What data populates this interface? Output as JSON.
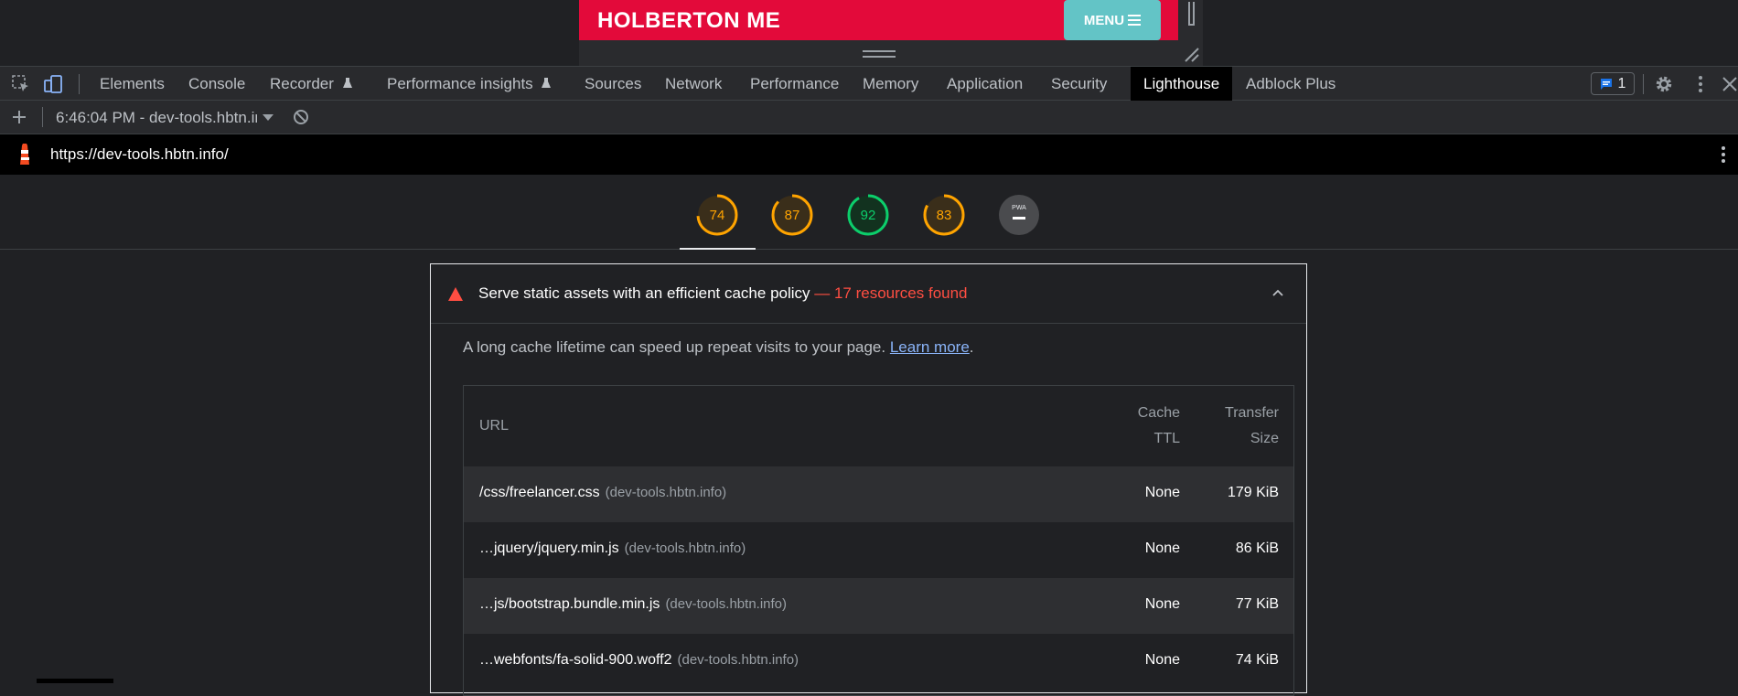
{
  "preview": {
    "site_title": "HOLBERTON ME",
    "menu_label": "MENU"
  },
  "devtools": {
    "tabs": [
      {
        "label": "Elements"
      },
      {
        "label": "Console"
      },
      {
        "label": "Recorder"
      },
      {
        "label": "Performance insights"
      },
      {
        "label": "Sources"
      },
      {
        "label": "Network"
      },
      {
        "label": "Performance"
      },
      {
        "label": "Memory"
      },
      {
        "label": "Application"
      },
      {
        "label": "Security"
      },
      {
        "label": "Lighthouse"
      },
      {
        "label": "Adblock Plus"
      }
    ],
    "active_tab": "Lighthouse",
    "issues_count": "1"
  },
  "toolbar": {
    "report_label": "6:46:04 PM - dev-tools.hbtn.info"
  },
  "lighthouse": {
    "url": "https://dev-tools.hbtn.info/",
    "scores": [
      {
        "value": "74",
        "color": "#ffa400"
      },
      {
        "value": "87",
        "color": "#ffa400"
      },
      {
        "value": "92",
        "color": "#0cce6b"
      },
      {
        "value": "83",
        "color": "#ffa400"
      }
    ],
    "pwa_label": "PWA"
  },
  "audit": {
    "title": "Serve static assets with an efficient cache policy",
    "found": " — 17 resources found",
    "description": "A long cache lifetime can speed up repeat visits to your page. ",
    "learn_more": "Learn more",
    "period": ".",
    "headers": {
      "url": "URL",
      "cache_ttl_1": "Cache",
      "cache_ttl_2": "TTL",
      "transfer_1": "Transfer",
      "transfer_2": "Size"
    },
    "rows": [
      {
        "url": "/css/freelancer.css",
        "host": "(dev-tools.hbtn.info)",
        "ttl": "None",
        "size": "179 KiB"
      },
      {
        "url": "…jquery/jquery.min.js",
        "host": "(dev-tools.hbtn.info)",
        "ttl": "None",
        "size": "86 KiB"
      },
      {
        "url": "…js/bootstrap.bundle.min.js",
        "host": "(dev-tools.hbtn.info)",
        "ttl": "None",
        "size": "77 KiB"
      },
      {
        "url": "…webfonts/fa-solid-900.woff2",
        "host": "(dev-tools.hbtn.info)",
        "ttl": "None",
        "size": "74 KiB"
      }
    ]
  }
}
